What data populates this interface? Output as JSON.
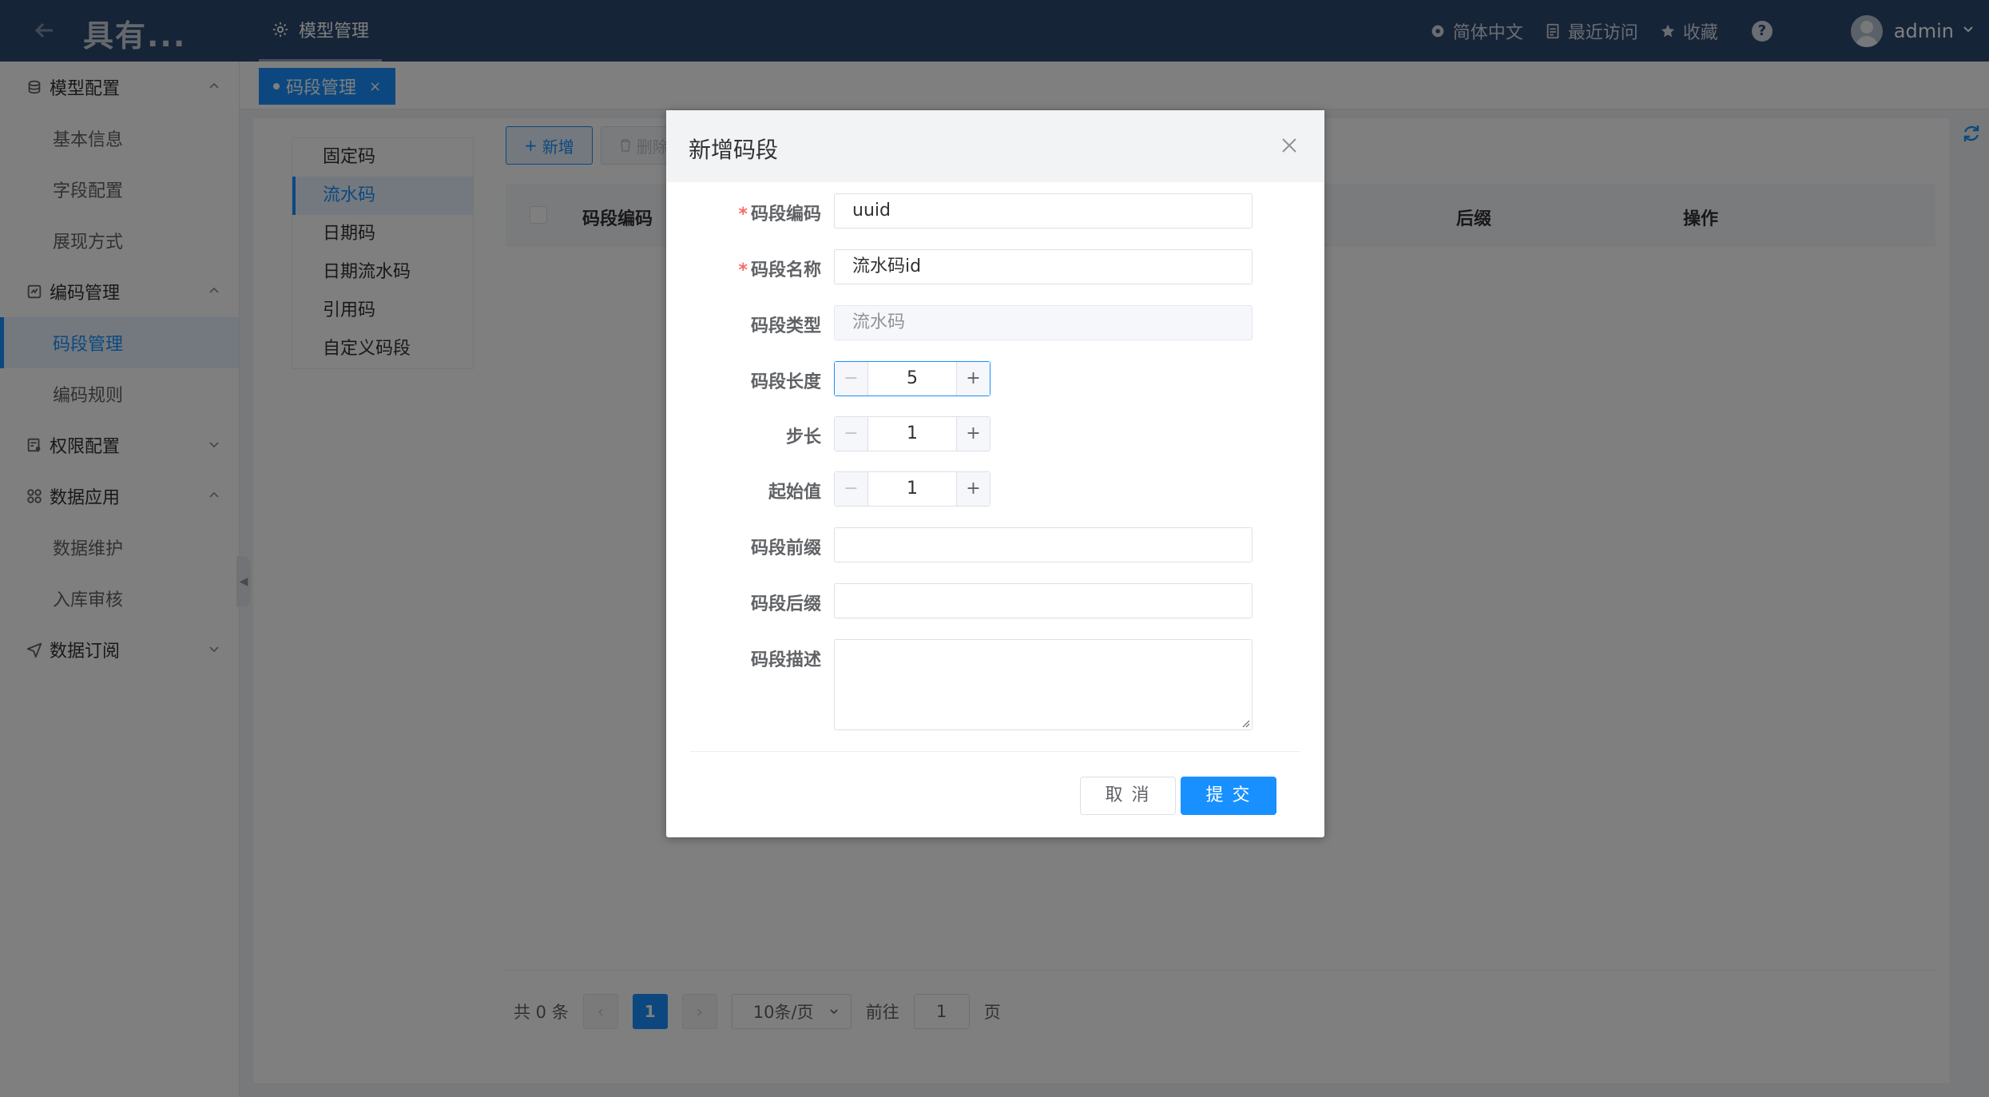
{
  "header": {
    "back_icon": "arrow-left-icon",
    "app_title": "具有...",
    "top_tab_label": "模型管理",
    "language": "简体中文",
    "recent": "最近访问",
    "favorites": "收藏",
    "help": "?",
    "user": "admin"
  },
  "sidebar": {
    "groups": [
      {
        "label": "模型配置",
        "icon": "model-icon",
        "items": [
          "基本信息",
          "字段配置",
          "展现方式"
        ]
      },
      {
        "label": "编码管理",
        "icon": "code-icon",
        "items": [
          "码段管理",
          "编码规则"
        ]
      },
      {
        "label": "权限配置",
        "icon": "permission-icon",
        "items": []
      },
      {
        "label": "数据应用",
        "icon": "apps-icon",
        "items": [
          "数据维护",
          "入库审核"
        ]
      },
      {
        "label": "数据订阅",
        "icon": "send-icon",
        "items": []
      }
    ],
    "active_item": "码段管理"
  },
  "tagbar": {
    "tag_label": "码段管理",
    "close": "×"
  },
  "content": {
    "types": [
      "固定码",
      "流水码",
      "日期码",
      "日期流水码",
      "引用码",
      "自定义码段"
    ],
    "active_type": "流水码",
    "toolbar": {
      "add_label": "新增",
      "delete_label": "删除"
    },
    "table": {
      "headers": [
        "码段编码",
        "后缀",
        "操作"
      ]
    },
    "pager": {
      "total": "共 0 条",
      "current_page": "1",
      "page_size": "10条/页",
      "goto_prefix": "前往",
      "goto_value": "1",
      "goto_suffix": "页"
    }
  },
  "dialog": {
    "title": "新增码段",
    "fields": {
      "code": {
        "label": "码段编码",
        "value": "uuid",
        "required": true
      },
      "name": {
        "label": "码段名称",
        "value": "流水码id",
        "required": true
      },
      "type": {
        "label": "码段类型",
        "value": "流水码"
      },
      "length": {
        "label": "码段长度",
        "value": "5"
      },
      "step": {
        "label": "步长",
        "value": "1"
      },
      "start": {
        "label": "起始值",
        "value": "1"
      },
      "prefix": {
        "label": "码段前缀",
        "value": ""
      },
      "suffix": {
        "label": "码段后缀",
        "value": ""
      },
      "desc": {
        "label": "码段描述",
        "value": ""
      }
    },
    "cancel_label": "取 消",
    "submit_label": "提 交"
  },
  "colors": {
    "header_bg": "#2c4870",
    "accent": "#1890ff",
    "required": "#f56c6c"
  }
}
